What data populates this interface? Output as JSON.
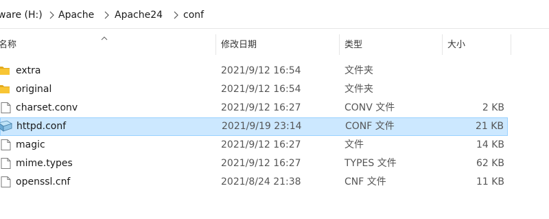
{
  "breadcrumb": {
    "items": [
      "ware (H:)",
      "Apache",
      "Apache24",
      "conf"
    ]
  },
  "columns": {
    "name": "名称",
    "date": "修改日期",
    "type": "类型",
    "size": "大小",
    "sort_indicator": "ascending"
  },
  "files": [
    {
      "name": "extra",
      "date": "2021/9/12 16:54",
      "type": "文件夹",
      "size": "",
      "icon": "folder-icon"
    },
    {
      "name": "original",
      "date": "2021/9/12 16:54",
      "type": "文件夹",
      "size": "",
      "icon": "folder-icon"
    },
    {
      "name": "charset.conv",
      "date": "2021/9/12 16:27",
      "type": "CONV 文件",
      "size": "2 KB",
      "icon": "file-icon"
    },
    {
      "name": "httpd.conf",
      "date": "2021/9/19 23:14",
      "type": "CONF 文件",
      "size": "21 KB",
      "icon": "conf-file-icon",
      "selected": true
    },
    {
      "name": "magic",
      "date": "2021/9/12 16:27",
      "type": "文件",
      "size": "14 KB",
      "icon": "file-icon"
    },
    {
      "name": "mime.types",
      "date": "2021/9/12 16:27",
      "type": "TYPES 文件",
      "size": "62 KB",
      "icon": "file-icon"
    },
    {
      "name": "openssl.cnf",
      "date": "2021/8/24 21:38",
      "type": "CNF 文件",
      "size": "11 KB",
      "icon": "file-icon"
    }
  ],
  "colors": {
    "selection_bg": "#cce8ff",
    "selection_border": "#99d1ff",
    "folder": "#f8c534"
  }
}
